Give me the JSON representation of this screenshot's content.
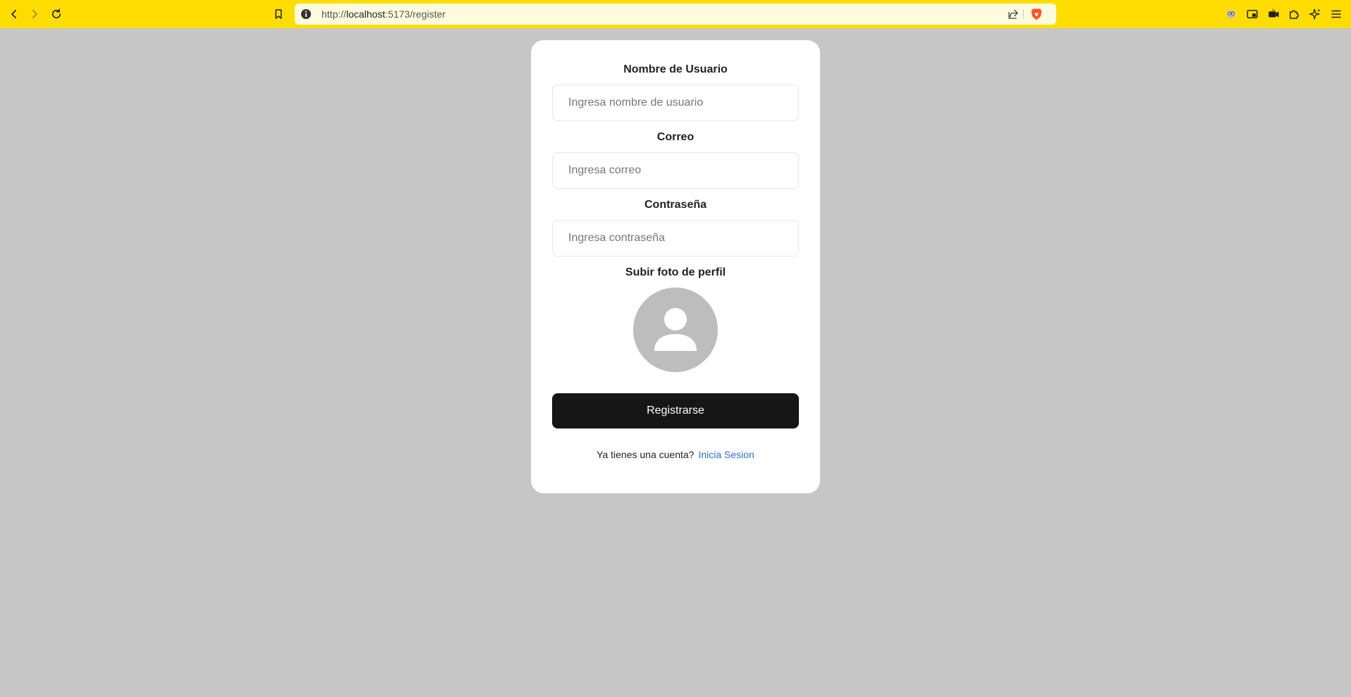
{
  "browser": {
    "url_prefix": "http://",
    "url_host": "localhost",
    "url_rest": ":5173/register"
  },
  "icons": {
    "back": "back-arrow-icon",
    "forward": "forward-arrow-icon",
    "reload": "reload-icon",
    "bookmark": "bookmark-icon",
    "info": "info-icon",
    "share": "share-icon",
    "brave": "brave-shield-icon",
    "extensions": [
      "glasses-extension-icon",
      "pip-icon",
      "camera-extension-icon",
      "puzzle-icon",
      "sparkle-icon",
      "menu-icon"
    ]
  },
  "form": {
    "username_label": "Nombre de Usuario",
    "username_placeholder": "Ingresa nombre de usuario",
    "email_label": "Correo",
    "email_placeholder": "Ingresa correo",
    "password_label": "Contraseña",
    "password_placeholder": "Ingresa contraseña",
    "photo_label": "Subir foto de perfil",
    "submit_label": "Registrarse",
    "footer_text": "Ya tienes una cuenta?",
    "login_link": "Inicia Sesion"
  },
  "colors": {
    "toolbar": "#ffdd00",
    "background": "#c6c6c6",
    "button": "#161616",
    "link": "#2f6fd6",
    "avatar": "#bdbdbd"
  }
}
